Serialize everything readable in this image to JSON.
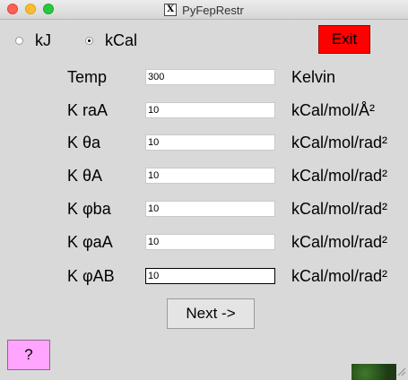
{
  "window": {
    "title": "PyFepRestr",
    "title_icon": "x11-icon"
  },
  "units": {
    "options": [
      {
        "label": "kJ",
        "selected": false
      },
      {
        "label": "kCal",
        "selected": true
      }
    ]
  },
  "buttons": {
    "exit": "Exit",
    "next": "Next ->",
    "help": "?"
  },
  "colors": {
    "exit": "#ff0000",
    "help": "#ffa5ff",
    "background": "#d9d9d9"
  },
  "fields": [
    {
      "label": "Temp",
      "value": "300",
      "unit": "Kelvin"
    },
    {
      "label": "K raA",
      "value": "10",
      "unit": "kCal/mol/Å²"
    },
    {
      "label": "K θa",
      "value": "10",
      "unit": "kCal/mol/rad²"
    },
    {
      "label": "K θA",
      "value": "10",
      "unit": "kCal/mol/rad²"
    },
    {
      "label": "K φba",
      "value": "10",
      "unit": "kCal/mol/rad²"
    },
    {
      "label": "K φaA",
      "value": "10",
      "unit": "kCal/mol/rad²"
    },
    {
      "label": "K φAB",
      "value": "10",
      "unit": "kCal/mol/rad²"
    }
  ]
}
